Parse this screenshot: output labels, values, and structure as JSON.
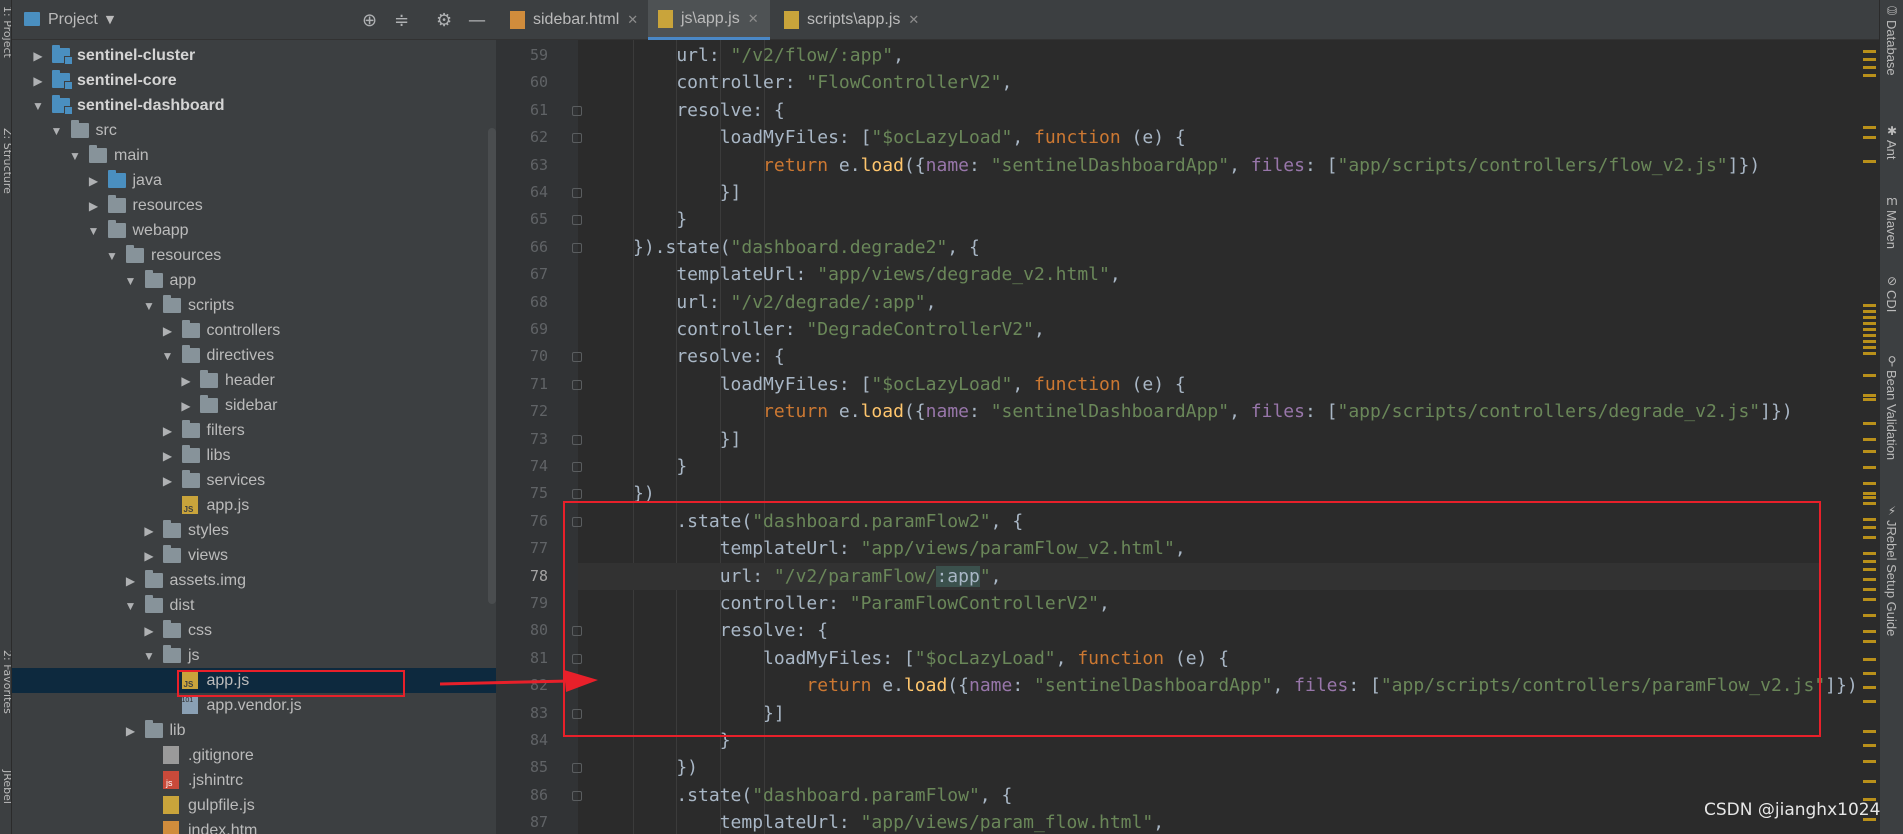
{
  "left_strip": {
    "project_label": "1: Project",
    "structure_label": "Z: Structure",
    "favorites_label": "2: Favorites",
    "jrebel_label": "JRebel"
  },
  "project_panel": {
    "title": "Project",
    "tree": [
      {
        "label": "sentinel-cluster",
        "depth": 0,
        "arrow": "right",
        "icon": "module-folder",
        "bold": true
      },
      {
        "label": "sentinel-core",
        "depth": 0,
        "arrow": "right",
        "icon": "module-folder",
        "bold": true
      },
      {
        "label": "sentinel-dashboard",
        "depth": 0,
        "arrow": "down",
        "icon": "module-folder",
        "bold": true
      },
      {
        "label": "src",
        "depth": 1,
        "arrow": "down",
        "icon": "folder"
      },
      {
        "label": "main",
        "depth": 2,
        "arrow": "down",
        "icon": "folder"
      },
      {
        "label": "java",
        "depth": 3,
        "arrow": "right",
        "icon": "source-folder"
      },
      {
        "label": "resources",
        "depth": 3,
        "arrow": "right",
        "icon": "resource-folder"
      },
      {
        "label": "webapp",
        "depth": 3,
        "arrow": "down",
        "icon": "resource-folder"
      },
      {
        "label": "resources",
        "depth": 4,
        "arrow": "down",
        "icon": "folder"
      },
      {
        "label": "app",
        "depth": 5,
        "arrow": "down",
        "icon": "folder"
      },
      {
        "label": "scripts",
        "depth": 6,
        "arrow": "down",
        "icon": "folder"
      },
      {
        "label": "controllers",
        "depth": 7,
        "arrow": "right",
        "icon": "folder"
      },
      {
        "label": "directives",
        "depth": 7,
        "arrow": "down",
        "icon": "folder"
      },
      {
        "label": "header",
        "depth": 8,
        "arrow": "right",
        "icon": "folder"
      },
      {
        "label": "sidebar",
        "depth": 8,
        "arrow": "right",
        "icon": "folder"
      },
      {
        "label": "filters",
        "depth": 7,
        "arrow": "right",
        "icon": "folder"
      },
      {
        "label": "libs",
        "depth": 7,
        "arrow": "right",
        "icon": "folder"
      },
      {
        "label": "services",
        "depth": 7,
        "arrow": "right",
        "icon": "folder"
      },
      {
        "label": "app.js",
        "depth": 7,
        "arrow": "none",
        "icon": "js-file"
      },
      {
        "label": "styles",
        "depth": 6,
        "arrow": "right",
        "icon": "folder"
      },
      {
        "label": "views",
        "depth": 6,
        "arrow": "right",
        "icon": "folder"
      },
      {
        "label": "assets.img",
        "depth": 5,
        "arrow": "right",
        "icon": "folder"
      },
      {
        "label": "dist",
        "depth": 5,
        "arrow": "down",
        "icon": "folder"
      },
      {
        "label": "css",
        "depth": 6,
        "arrow": "right",
        "icon": "folder"
      },
      {
        "label": "js",
        "depth": 6,
        "arrow": "down",
        "icon": "folder"
      },
      {
        "label": "app.js",
        "depth": 7,
        "arrow": "none",
        "icon": "js-file",
        "selected": true
      },
      {
        "label": "app.vendor.js",
        "depth": 7,
        "arrow": "none",
        "icon": "vendor-file"
      },
      {
        "label": "lib",
        "depth": 5,
        "arrow": "right",
        "icon": "folder"
      },
      {
        "label": ".gitignore",
        "depth": 6,
        "arrow": "none",
        "icon": "git-file"
      },
      {
        "label": ".jshintrc",
        "depth": 6,
        "arrow": "none",
        "icon": "jshint-file"
      },
      {
        "label": "gulpfile.js",
        "depth": 6,
        "arrow": "none",
        "icon": "gulp-file"
      },
      {
        "label": "index.htm",
        "depth": 6,
        "arrow": "none",
        "icon": "html-file"
      }
    ]
  },
  "tabs": [
    {
      "label": "sidebar.html",
      "icon": "html-file",
      "active": false
    },
    {
      "label": "js\\app.js",
      "icon": "js-file",
      "active": true
    },
    {
      "label": "scripts\\app.js",
      "icon": "js-file",
      "active": false
    }
  ],
  "editor": {
    "current_line": 78,
    "lines": [
      {
        "n": 59,
        "fold": false,
        "tokens": [
          [
            "",
            "    url: "
          ],
          [
            "s",
            "\"/v2/flow/:app\""
          ],
          [
            "",
            ","
          ]
        ]
      },
      {
        "n": 60,
        "fold": false,
        "tokens": [
          [
            "",
            "    controller: "
          ],
          [
            "s",
            "\"FlowControllerV2\""
          ],
          [
            "",
            ","
          ]
        ]
      },
      {
        "n": 61,
        "fold": true,
        "tokens": [
          [
            "",
            "    resolve: {"
          ]
        ]
      },
      {
        "n": 62,
        "fold": true,
        "tokens": [
          [
            "",
            "        loadMyFiles: ["
          ],
          [
            "s",
            "\"$ocLazyLoad\""
          ],
          [
            "",
            ", "
          ],
          [
            "k",
            "function"
          ],
          [
            "",
            " (e) {"
          ]
        ]
      },
      {
        "n": 63,
        "fold": false,
        "tokens": [
          [
            "",
            "            "
          ],
          [
            "k",
            "return"
          ],
          [
            "",
            " e."
          ],
          [
            "f",
            "load"
          ],
          [
            "",
            "({"
          ],
          [
            "p",
            "name"
          ],
          [
            "",
            ": "
          ],
          [
            "s",
            "\"sentinelDashboardApp\""
          ],
          [
            "",
            ", "
          ],
          [
            "p",
            "files"
          ],
          [
            "",
            ": ["
          ],
          [
            "s",
            "\"app/scripts/controllers/flow_v2.js\""
          ],
          [
            "",
            "]})"
          ]
        ]
      },
      {
        "n": 64,
        "fold": true,
        "tokens": [
          [
            "",
            "        }]"
          ]
        ]
      },
      {
        "n": 65,
        "fold": true,
        "tokens": [
          [
            "",
            "    }"
          ]
        ]
      },
      {
        "n": 66,
        "fold": true,
        "tokens": [
          [
            "",
            "}).state("
          ],
          [
            "s",
            "\"dashboard.degrade2\""
          ],
          [
            "",
            ", {"
          ]
        ]
      },
      {
        "n": 67,
        "fold": false,
        "tokens": [
          [
            "",
            "    templateUrl: "
          ],
          [
            "s",
            "\"app/views/degrade_v2.html\""
          ],
          [
            "",
            ","
          ]
        ]
      },
      {
        "n": 68,
        "fold": false,
        "tokens": [
          [
            "",
            "    url: "
          ],
          [
            "s",
            "\"/v2/degrade/:app\""
          ],
          [
            "",
            ","
          ]
        ]
      },
      {
        "n": 69,
        "fold": false,
        "tokens": [
          [
            "",
            "    controller: "
          ],
          [
            "s",
            "\"DegradeControllerV2\""
          ],
          [
            "",
            ","
          ]
        ]
      },
      {
        "n": 70,
        "fold": true,
        "tokens": [
          [
            "",
            "    resolve: {"
          ]
        ]
      },
      {
        "n": 71,
        "fold": true,
        "tokens": [
          [
            "",
            "        loadMyFiles: ["
          ],
          [
            "s",
            "\"$ocLazyLoad\""
          ],
          [
            "",
            ", "
          ],
          [
            "k",
            "function"
          ],
          [
            "",
            " (e) {"
          ]
        ]
      },
      {
        "n": 72,
        "fold": false,
        "tokens": [
          [
            "",
            "            "
          ],
          [
            "k",
            "return"
          ],
          [
            "",
            " e."
          ],
          [
            "f",
            "load"
          ],
          [
            "",
            "({"
          ],
          [
            "p",
            "name"
          ],
          [
            "",
            ": "
          ],
          [
            "s",
            "\"sentinelDashboardApp\""
          ],
          [
            "",
            ", "
          ],
          [
            "p",
            "files"
          ],
          [
            "",
            ": ["
          ],
          [
            "s",
            "\"app/scripts/controllers/degrade_v2.js\""
          ],
          [
            "",
            "]})"
          ]
        ]
      },
      {
        "n": 73,
        "fold": true,
        "tokens": [
          [
            "",
            "        }]"
          ]
        ]
      },
      {
        "n": 74,
        "fold": true,
        "tokens": [
          [
            "",
            "    }"
          ]
        ]
      },
      {
        "n": 75,
        "fold": true,
        "tokens": [
          [
            "",
            "})"
          ]
        ]
      },
      {
        "n": 76,
        "fold": true,
        "tokens": [
          [
            "",
            "    .state("
          ],
          [
            "s",
            "\"dashboard.paramFlow2\""
          ],
          [
            "",
            ", {"
          ]
        ]
      },
      {
        "n": 77,
        "fold": false,
        "tokens": [
          [
            "",
            "        templateUrl: "
          ],
          [
            "s",
            "\"app/views/paramFlow_v2.html\""
          ],
          [
            "",
            ","
          ]
        ]
      },
      {
        "n": 78,
        "fold": false,
        "tokens": [
          [
            "",
            "        url: "
          ],
          [
            "s",
            "\"/v2/paramFlow/"
          ],
          [
            "hl",
            ":app"
          ],
          [
            "s",
            "\""
          ],
          [
            "",
            ","
          ]
        ]
      },
      {
        "n": 79,
        "fold": false,
        "tokens": [
          [
            "",
            "        controller: "
          ],
          [
            "s",
            "\"ParamFlowControllerV2\""
          ],
          [
            "",
            ","
          ]
        ]
      },
      {
        "n": 80,
        "fold": true,
        "tokens": [
          [
            "",
            "        resolve: {"
          ]
        ]
      },
      {
        "n": 81,
        "fold": true,
        "tokens": [
          [
            "",
            "            loadMyFiles: ["
          ],
          [
            "s",
            "\"$ocLazyLoad\""
          ],
          [
            "",
            ", "
          ],
          [
            "k",
            "function"
          ],
          [
            "",
            " (e) {"
          ]
        ]
      },
      {
        "n": 82,
        "fold": false,
        "tokens": [
          [
            "",
            "                "
          ],
          [
            "k",
            "return"
          ],
          [
            "",
            " e."
          ],
          [
            "f",
            "load"
          ],
          [
            "",
            "({"
          ],
          [
            "p",
            "name"
          ],
          [
            "",
            ": "
          ],
          [
            "s",
            "\"sentinelDashboardApp\""
          ],
          [
            "",
            ", "
          ],
          [
            "p",
            "files"
          ],
          [
            "",
            ": ["
          ],
          [
            "s",
            "\"app/scripts/controllers/paramFlow_v2.js\""
          ],
          [
            "",
            "]})"
          ]
        ]
      },
      {
        "n": 83,
        "fold": true,
        "tokens": [
          [
            "",
            "            }]"
          ]
        ]
      },
      {
        "n": 84,
        "fold": false,
        "tokens": [
          [
            "",
            "        }"
          ]
        ]
      },
      {
        "n": 85,
        "fold": true,
        "tokens": [
          [
            "",
            "    })"
          ]
        ]
      },
      {
        "n": 86,
        "fold": true,
        "tokens": [
          [
            "",
            "    .state("
          ],
          [
            "s",
            "\"dashboard.paramFlow\""
          ],
          [
            "",
            ", {"
          ]
        ]
      },
      {
        "n": 87,
        "fold": false,
        "tokens": [
          [
            "",
            "        templateUrl: "
          ],
          [
            "s",
            "\"app/views/param_flow.html\""
          ],
          [
            "",
            ","
          ]
        ]
      }
    ]
  },
  "right_strip": [
    "Database",
    "Ant",
    "Maven",
    "CDI",
    "Bean Validation",
    "JRebel Setup Guide"
  ],
  "watermark": "CSDN @jianghx1024",
  "colors": {
    "keyword": "#cc7832",
    "string": "#6a8759",
    "property": "#9876aa",
    "function": "#ffc66d",
    "annotation_red": "#e8202a"
  }
}
